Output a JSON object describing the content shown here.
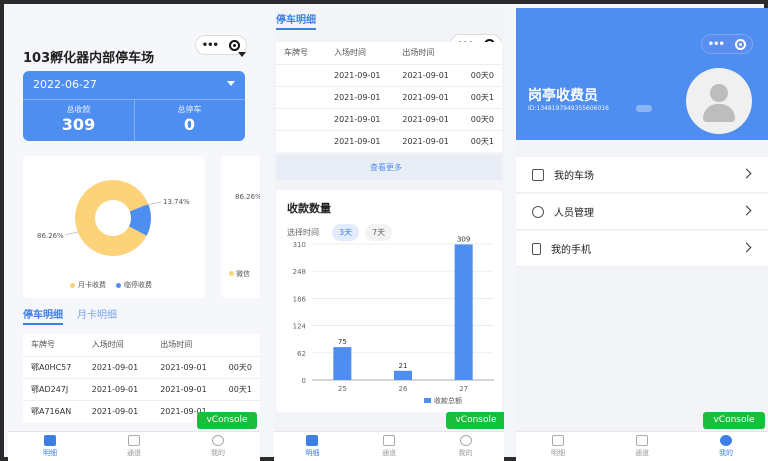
{
  "panel1": {
    "lot_title": "103孵化器内部停车场",
    "date": "2022-06-27",
    "stats": [
      {
        "label": "总收款",
        "value": "309"
      },
      {
        "label": "总停车",
        "value": "0"
      }
    ],
    "pie_labels": {
      "big": "86.26%",
      "small": "13.74%"
    },
    "legend": [
      "月卡收费",
      "临停收费"
    ],
    "side_label": "86.26%",
    "side_legend": "微信",
    "tabs": [
      "停车明细",
      "月卡明细"
    ],
    "table": {
      "headers": [
        "车牌号",
        "入场时间",
        "出场时间",
        ""
      ],
      "rows": [
        [
          "鄂A0HC57",
          "2021-09-01",
          "2021-09-01",
          "00天0"
        ],
        [
          "鄂AD247J",
          "2021-09-01",
          "2021-09-01",
          "00天1"
        ],
        [
          "鄂A716AN",
          "2021-09-01",
          "2021-09-01",
          ""
        ]
      ]
    }
  },
  "panel2": {
    "header_tab": "停车明细",
    "table": {
      "headers": [
        "车牌号",
        "入场时间",
        "出场时间"
      ],
      "rows": [
        [
          "",
          "2021-09-01",
          "2021-09-01",
          "00天0"
        ],
        [
          "",
          "2021-09-01",
          "2021-09-01",
          "00天1"
        ],
        [
          "",
          "2021-09-01",
          "2021-09-01",
          "00天0"
        ],
        [
          "",
          "2021-09-01",
          "2021-09-01",
          "00天1"
        ]
      ]
    },
    "more": "查看更多",
    "chart_title": "收款数量",
    "filters": [
      "选择时间",
      "3天",
      "7天"
    ],
    "legend": "收款总额"
  },
  "panel3": {
    "role": "岗亭收费员",
    "user_id": "ID:13481979493556060​16",
    "menu": [
      "我的车场",
      "人员管理",
      "我的手机"
    ]
  },
  "common": {
    "vconsole": "vConsole",
    "tabbar": [
      "明细",
      "通道",
      "我的"
    ]
  },
  "colors": {
    "primary": "#4d8ef0",
    "yellow": "#fdd37a",
    "green": "#19be3b"
  },
  "chart_data": [
    {
      "type": "pie",
      "labels": [
        "月卡收费",
        "临停收费"
      ],
      "values": [
        86.26,
        13.74
      ],
      "colors": [
        "#fdd37a",
        "#4d8ef0"
      ]
    },
    {
      "type": "bar",
      "title": "收款数量",
      "categories": [
        "25",
        "26",
        "27"
      ],
      "series": [
        {
          "name": "收款总额",
          "values": [
            75,
            21,
            309
          ]
        }
      ],
      "ylim": [
        0,
        310
      ],
      "yticks": [
        0,
        62,
        124,
        186,
        248,
        310
      ]
    }
  ]
}
